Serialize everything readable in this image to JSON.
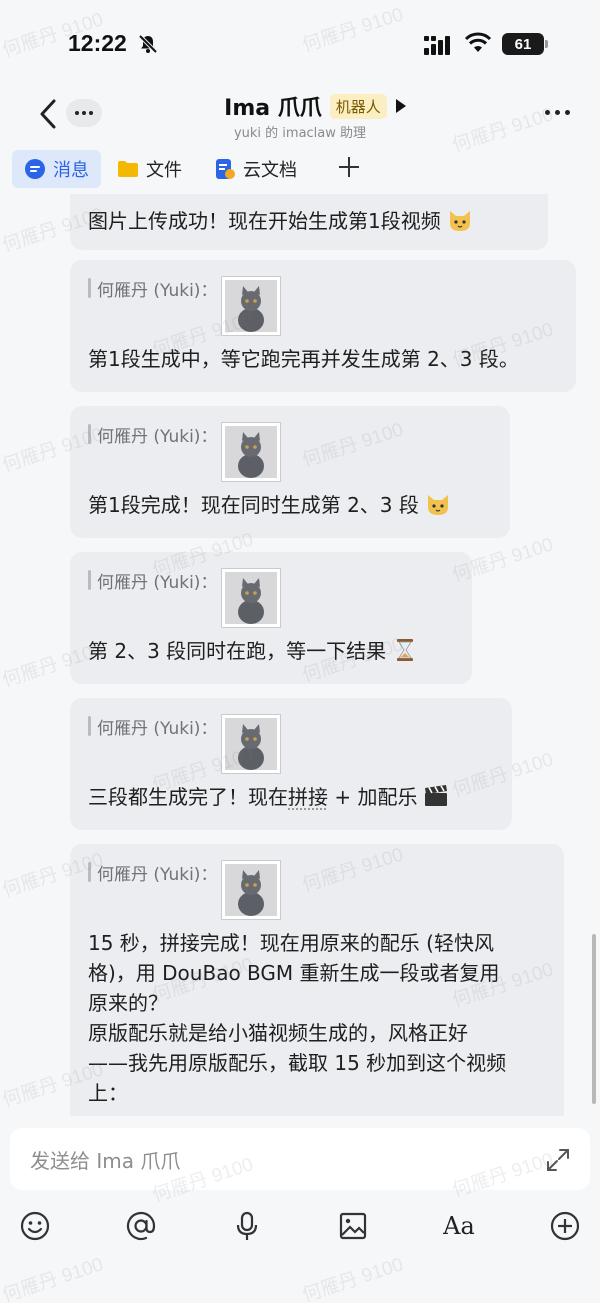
{
  "status_bar": {
    "time": "12:22",
    "battery": "61"
  },
  "header": {
    "title": "Ima 爪爪",
    "badge": "机器人",
    "subtitle": "yuki 的 imaclaw 助理"
  },
  "tabs": [
    {
      "label": "消息",
      "icon": "chat-bubble-icon",
      "active": true
    },
    {
      "label": "文件",
      "icon": "folder-icon",
      "active": false
    },
    {
      "label": "云文档",
      "icon": "cloud-doc-icon",
      "active": false
    }
  ],
  "messages": [
    {
      "text": "图片上传成功！现在开始生成第1段视频",
      "emoji": "cat-face"
    },
    {
      "quote_author": "何雁丹 (Yuki)：",
      "text": "第1段生成中，等它跑完再并发生成第 2、3 段。"
    },
    {
      "quote_author": "何雁丹 (Yuki)：",
      "text": "第1段完成！现在同时生成第 2、3 段",
      "emoji": "cat-face"
    },
    {
      "quote_author": "何雁丹 (Yuki)：",
      "text": "第 2、3 段同时在跑，等一下结果",
      "emoji": "hourglass"
    },
    {
      "quote_author": "何雁丹 (Yuki)：",
      "text_before": "三段都生成完了！现在",
      "text_underlined": "拼接",
      "text_after": " + 加配乐",
      "emoji": "clapperboard"
    },
    {
      "quote_author": "何雁丹 (Yuki)：",
      "lines": [
        "15 秒，拼接完成！现在用原来的配乐 (轻快风",
        "格)，用 DouBao BGM 重新生成一段或者复用",
        "原来的？",
        "原版配乐就是给小猫视频生成的，风格正好",
        "——我先用原版配乐，截取 15 秒加到这个视频",
        "上："
      ]
    }
  ],
  "input": {
    "placeholder": "发送给 Ima 爪爪"
  },
  "toolbar": [
    "emoji-icon",
    "mention-icon",
    "microphone-icon",
    "image-icon",
    "text-format-icon",
    "add-icon"
  ],
  "toolbar_text_label": "Aa",
  "watermark": "何雁丹 9100",
  "colors": {
    "accent": "#2c64e8",
    "bubble": "#ebedf0",
    "badge_bg": "#fbeec2",
    "background": "#f6f7f8"
  }
}
